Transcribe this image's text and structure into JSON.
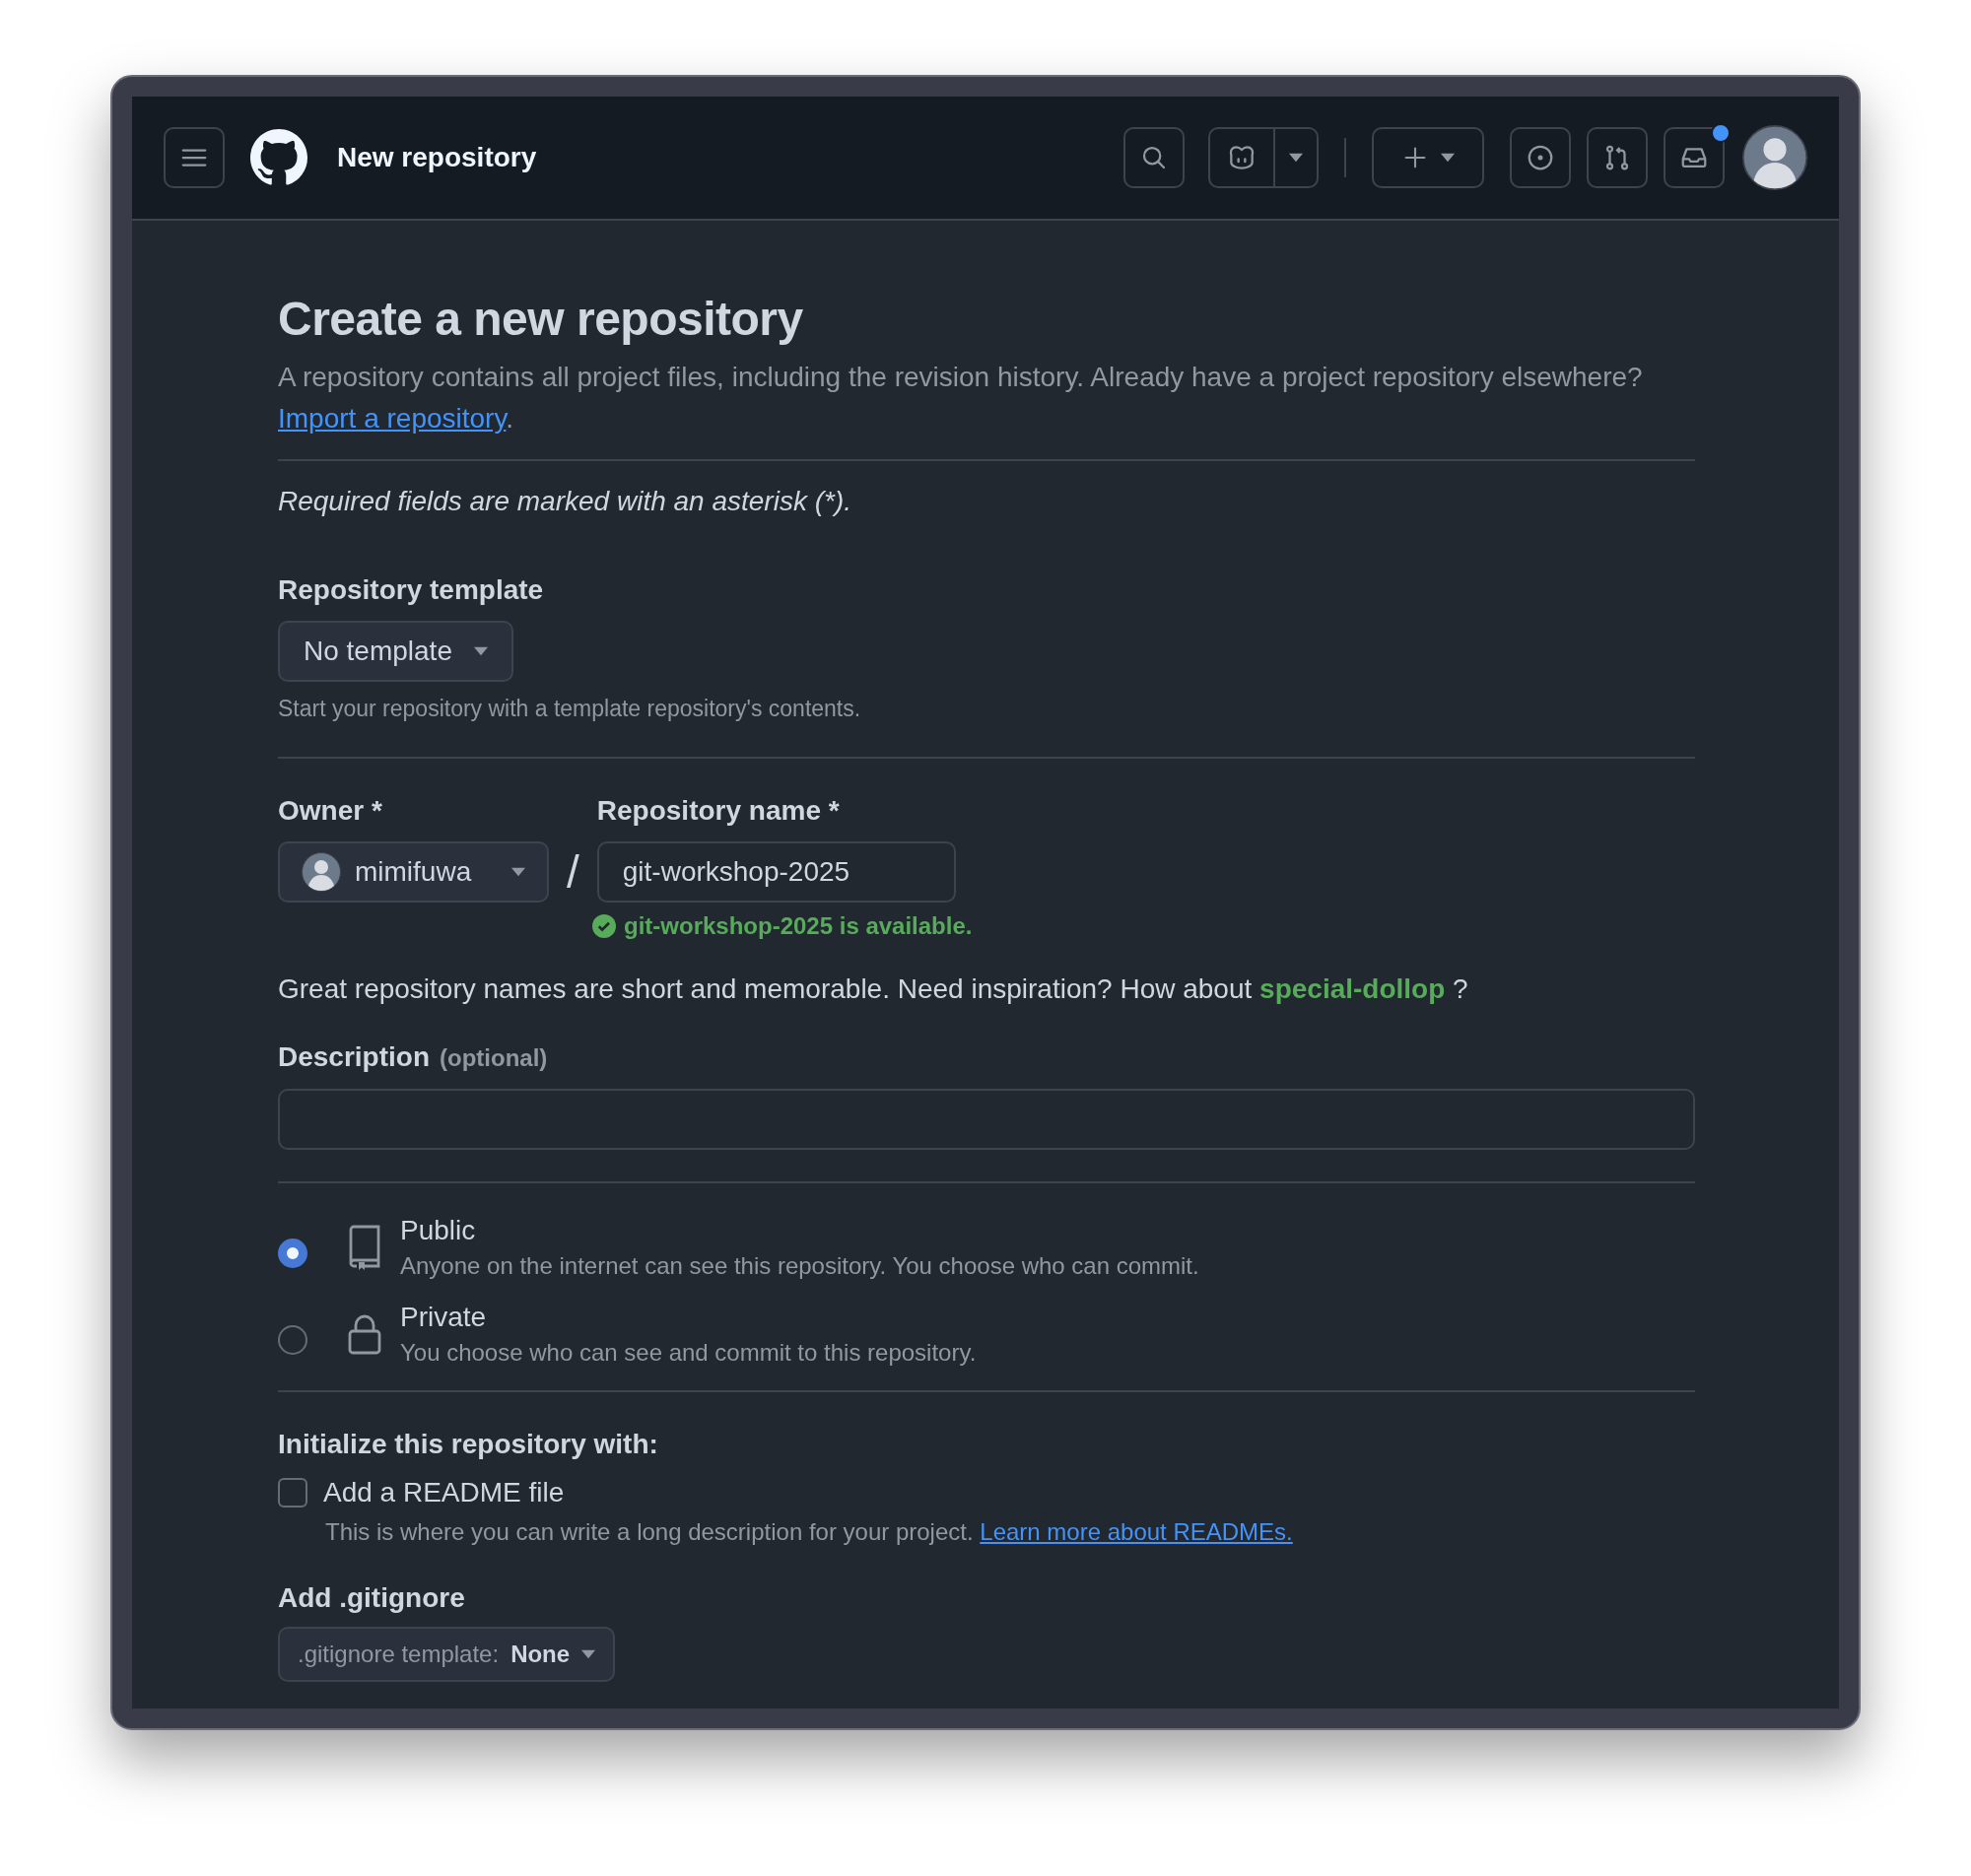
{
  "header": {
    "title": "New repository",
    "notification_unread": true
  },
  "page": {
    "title": "Create a new repository",
    "intro": {
      "text": "A repository contains all project files, including the revision history. Already have a project repository elsewhere?",
      "link": "Import a repository",
      "end": "."
    },
    "required_note": "Required fields are marked with an asterisk (*).",
    "template": {
      "label": "Repository template",
      "value": "No template",
      "help": "Start your repository with a template repository's contents."
    },
    "owner": {
      "label": "Owner *",
      "value": "mimifuwa"
    },
    "separator": "/",
    "repo_name": {
      "label": "Repository name *",
      "value": "git-workshop-2025",
      "status": "git-workshop-2025 is available."
    },
    "suggestion": {
      "text": "Great repository names are short and memorable. Need inspiration? How about",
      "name": "special-dollop",
      "end": "?"
    },
    "description": {
      "label": "Description",
      "optional": "(optional)"
    },
    "visibility": [
      {
        "kind": "public",
        "title": "Public",
        "description": "Anyone on the internet can see this repository. You choose who can commit.",
        "selected": true
      },
      {
        "kind": "private",
        "title": "Private",
        "description": "You choose who can see and commit to this repository.",
        "selected": false
      }
    ],
    "initialize": {
      "heading": "Initialize this repository with:",
      "readme": {
        "label": "Add a README file",
        "checked": false,
        "help": "This is where you can write a long description for your project.",
        "link": "Learn more about READMEs."
      }
    },
    "gitignore": {
      "heading": "Add .gitignore",
      "prefix": ".gitignore template:",
      "value": "None"
    }
  }
}
